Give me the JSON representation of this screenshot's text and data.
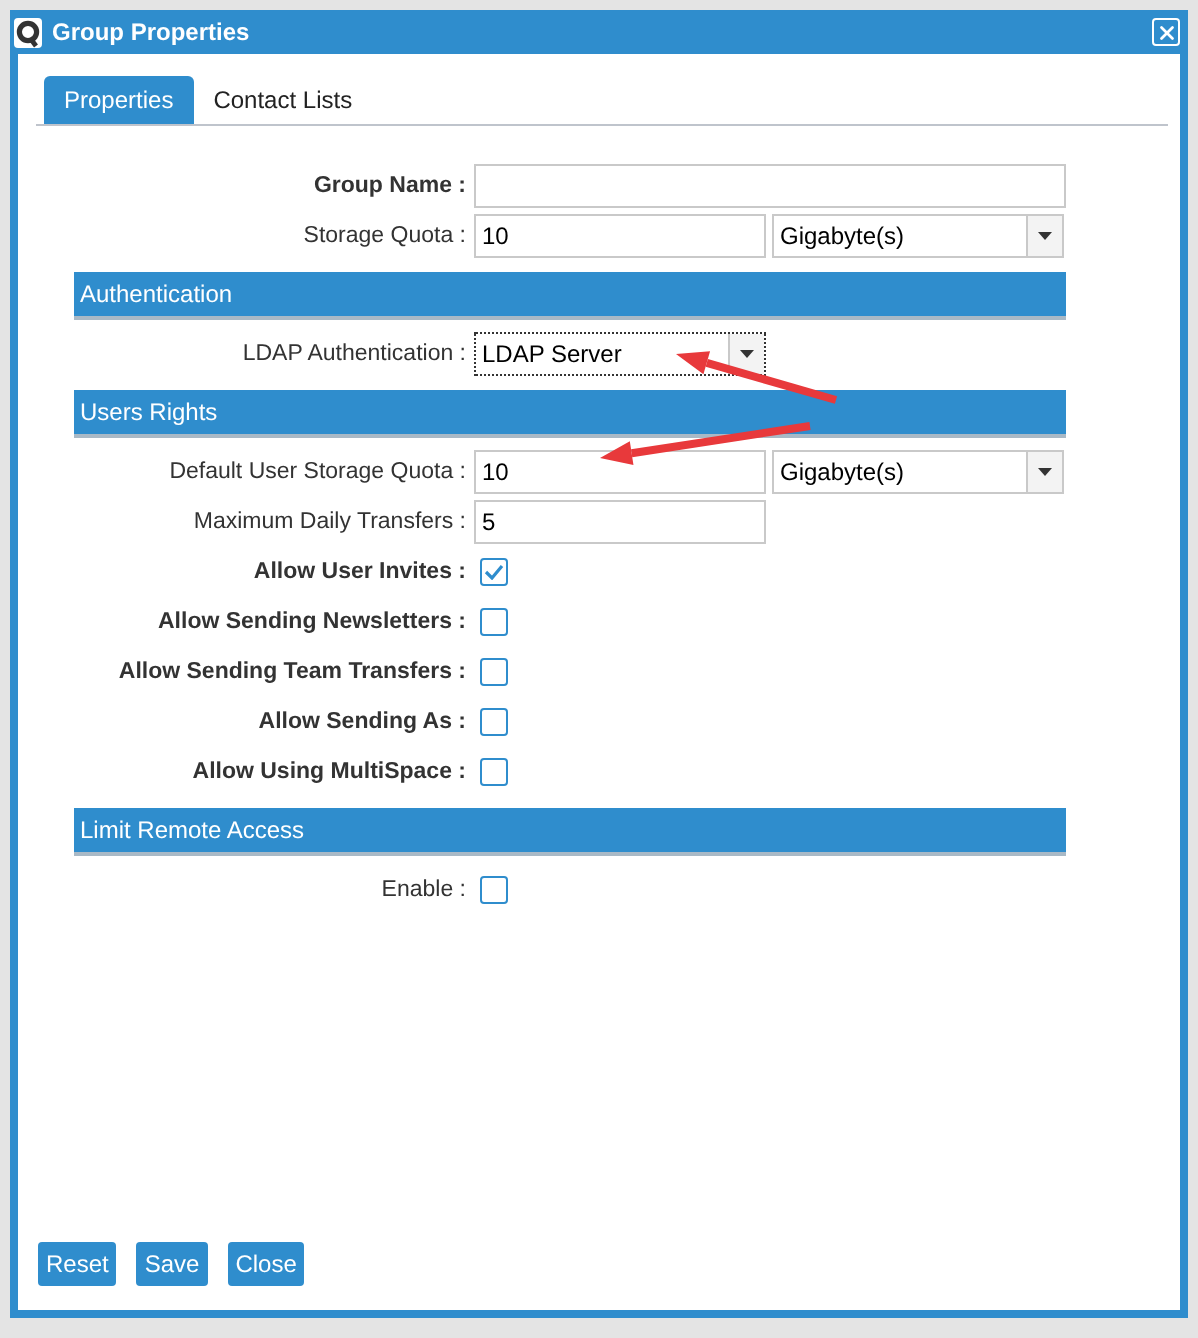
{
  "window": {
    "title": "Group Properties"
  },
  "tabs": [
    {
      "label": "Properties",
      "selected": true
    },
    {
      "label": "Contact Lists",
      "selected": false
    }
  ],
  "sections": [
    {
      "rows": [
        {
          "kind": "text",
          "label": "Group Name :",
          "bold": true,
          "value": "",
          "wide": true
        },
        {
          "kind": "quota",
          "label": "Storage Quota :",
          "bold": false,
          "value": "10",
          "unit": "Gigabyte(s)"
        }
      ]
    },
    {
      "title": "Authentication",
      "rows": [
        {
          "kind": "select",
          "label": "LDAP Authentication :",
          "bold": false,
          "value": "LDAP Server",
          "focused": true
        }
      ]
    },
    {
      "title": "Users Rights",
      "rows": [
        {
          "kind": "quota",
          "label": "Default User Storage Quota :",
          "bold": false,
          "value": "10",
          "unit": "Gigabyte(s)"
        },
        {
          "kind": "text",
          "label": "Maximum Daily Transfers :",
          "bold": false,
          "value": "5",
          "wide": false
        },
        {
          "kind": "checkbox",
          "label": "Allow User Invites :",
          "bold": true,
          "checked": true
        },
        {
          "kind": "checkbox",
          "label": "Allow Sending Newsletters :",
          "bold": true,
          "checked": false
        },
        {
          "kind": "checkbox",
          "label": "Allow Sending Team Transfers :",
          "bold": true,
          "checked": false
        },
        {
          "kind": "checkbox",
          "label": "Allow Sending As :",
          "bold": true,
          "checked": false
        },
        {
          "kind": "checkbox",
          "label": "Allow Using MultiSpace :",
          "bold": true,
          "checked": false
        }
      ]
    },
    {
      "title": "Limit Remote Access",
      "rows": [
        {
          "kind": "checkbox",
          "label": "Enable :",
          "bold": false,
          "checked": false
        }
      ]
    }
  ],
  "buttons": [
    "Reset",
    "Save",
    "Close"
  ]
}
